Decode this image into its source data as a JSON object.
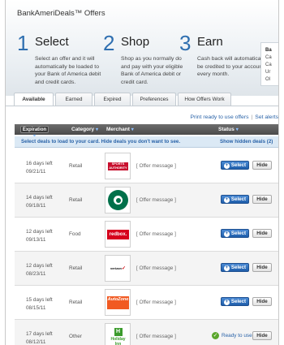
{
  "header": {
    "title": "BankAmeriDeals™ Offers",
    "steps": [
      {
        "num": "1",
        "title": "Select",
        "desc": "Select an offer and it will automatically be loaded to your Bank of America debit and credit cards."
      },
      {
        "num": "2",
        "title": "Shop",
        "desc": "Shop as you normally do and pay with your eligible Bank of America debit or credit card."
      },
      {
        "num": "3",
        "title": "Earn",
        "desc": "Cash back will automatically be credited to your account every month."
      }
    ],
    "side_panel": {
      "lines": [
        "Ba",
        "Ca",
        "Ca",
        "Ur",
        "Ol"
      ]
    }
  },
  "tabs": [
    {
      "label": "Available",
      "active": true
    },
    {
      "label": "Earned",
      "active": false
    },
    {
      "label": "Expired",
      "active": false
    },
    {
      "label": "Preferences",
      "active": false
    },
    {
      "label": "How Offers Work",
      "active": false
    }
  ],
  "links": {
    "print": "Print ready to use offers",
    "sep": "|",
    "alert": "Set alerts"
  },
  "table": {
    "columns": {
      "expiration": "Expiration",
      "category": "Category",
      "merchant": "Merchant",
      "status": "Status"
    },
    "sort_arrow": "▾",
    "info": {
      "left": "Select deals to load to your card. Hide deals you don't want to see.",
      "right": "Show hidden deals (2)"
    },
    "select_label": "Select",
    "hide_label": "Hide",
    "ready_label": "Ready to use",
    "rows": [
      {
        "days": "16 days left",
        "date": "09/21/11",
        "category": "Retail",
        "logo": "sports-authority",
        "logo_text": "SPORTS AUTHORITY",
        "message": "[ Offer message ]",
        "status": "select"
      },
      {
        "days": "14 days left",
        "date": "09/18/11",
        "category": "Retail",
        "logo": "starbucks",
        "logo_text": "",
        "message": "[ Offer message ]",
        "status": "select"
      },
      {
        "days": "12 days left",
        "date": "09/13/11",
        "category": "Food",
        "logo": "redbox",
        "logo_text": "redbox.",
        "message": "[ Offer message ]",
        "status": "select"
      },
      {
        "days": "12 days left",
        "date": "08/23/11",
        "category": "Retail",
        "logo": "verizon",
        "logo_text": "verizon",
        "message": "[ Offer message ]",
        "status": "select"
      },
      {
        "days": "15 days left",
        "date": "08/15/11",
        "category": "Retail",
        "logo": "autozone",
        "logo_text": "AutoZone",
        "message": "[ Offer message ]",
        "status": "select"
      },
      {
        "days": "17 days left",
        "date": "08/12/11",
        "category": "Other",
        "logo": "holiday-inn",
        "logo_text": "Holiday Inn",
        "message": "[ Offer message ]",
        "status": "ready"
      }
    ]
  }
}
